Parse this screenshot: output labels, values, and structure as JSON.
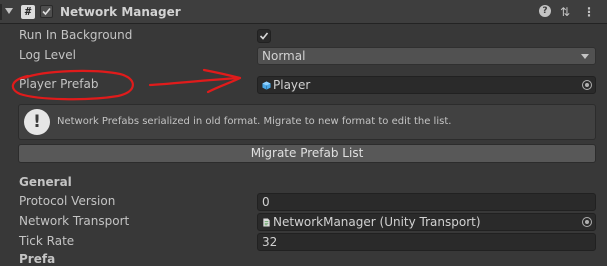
{
  "component": {
    "title": "Network Manager",
    "enabled": true,
    "script_icon_glyph": "#"
  },
  "header_icons": {
    "help": "help-icon",
    "presets": "presets-icon",
    "more": "more-icon",
    "help_glyph": "?",
    "presets_glyph": "⇅",
    "more_glyph": "⋮"
  },
  "properties": {
    "run_in_background": {
      "label": "Run In Background",
      "checked": true,
      "check_glyph": "✔"
    },
    "log_level": {
      "label": "Log Level",
      "value": "Normal"
    },
    "player_prefab": {
      "label": "Player Prefab",
      "value": "Player",
      "icon": "prefab-icon"
    },
    "protocol_version": {
      "label": "Protocol Version",
      "value": "0"
    },
    "network_transport": {
      "label": "Network Transport",
      "value": "NetworkManager (Unity Transport)",
      "icon": "script-file-icon"
    },
    "tick_rate": {
      "label": "Tick Rate",
      "value": "32"
    }
  },
  "helpbox": {
    "icon_glyph": "!",
    "message": "Network Prefabs serialized in old format. Migrate to new format to edit the list."
  },
  "migrate_button": {
    "label": "Migrate Prefab List"
  },
  "sections": {
    "general": "General",
    "partial": "Prefa"
  },
  "colors": {
    "background": "#383838",
    "annotation": "#e01b1b",
    "prefab_icon": "#4aa8e8"
  }
}
